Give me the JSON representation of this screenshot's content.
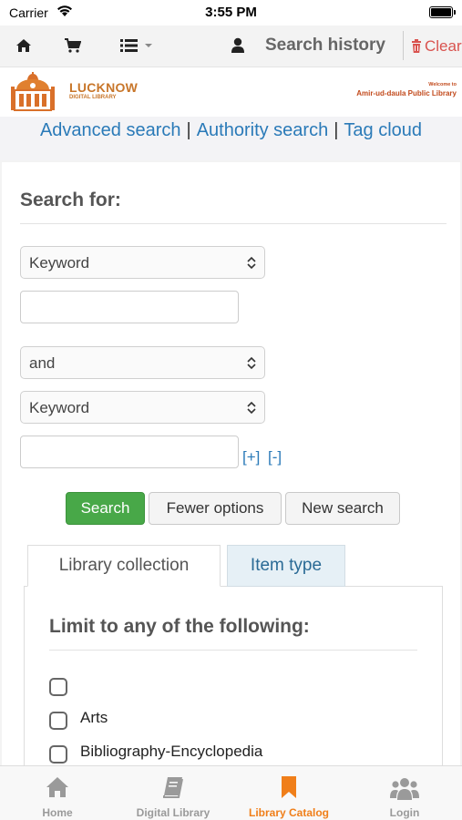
{
  "status_bar": {
    "carrier": "Carrier",
    "time": "3:55 PM"
  },
  "top_nav": {
    "icons": [
      "home-icon",
      "cart-icon",
      "list-icon",
      "user-icon"
    ],
    "search_history": "Search history",
    "clear": "Clear"
  },
  "branding": {
    "logo_title": "LUCKNOW",
    "logo_subtitle": "DIGITAL LIBRARY",
    "welcome_line1": "Welcome to",
    "welcome_line2": "Amir-ud-daula Public Library"
  },
  "links": {
    "advanced": "Advanced search",
    "authority": "Authority search",
    "tag_cloud": "Tag cloud",
    "separator": "|"
  },
  "search_form": {
    "heading": "Search for:",
    "field1_select": "Keyword",
    "field1_value": "",
    "operator_select": "and",
    "field2_select": "Keyword",
    "field2_value": "",
    "add_label": "[+]",
    "remove_label": "[-]",
    "search_button": "Search",
    "fewer_options_button": "Fewer options",
    "new_search_button": "New search"
  },
  "limits": {
    "tabs": [
      {
        "label": "Library collection",
        "active": true
      },
      {
        "label": "Item type",
        "active": false
      }
    ],
    "heading": "Limit to any of the following:",
    "options": [
      {
        "label": "",
        "checked": false
      },
      {
        "label": "Arts",
        "checked": false
      },
      {
        "label": "Bibliography-Encyclopedia",
        "checked": false
      }
    ]
  },
  "tab_bar": {
    "items": [
      {
        "label": "Home",
        "icon": "home-icon",
        "active": false
      },
      {
        "label": "Digital Library",
        "icon": "book-icon",
        "active": false
      },
      {
        "label": "Library Catalog",
        "icon": "bookmark-icon",
        "active": true
      },
      {
        "label": "Login",
        "icon": "users-icon",
        "active": false
      }
    ]
  },
  "colors": {
    "link": "#2a7ab8",
    "search_button": "#48a848",
    "clear": "#d9534f",
    "tab_active": "#f07f1a",
    "tab_inactive": "#9a9a9a"
  }
}
